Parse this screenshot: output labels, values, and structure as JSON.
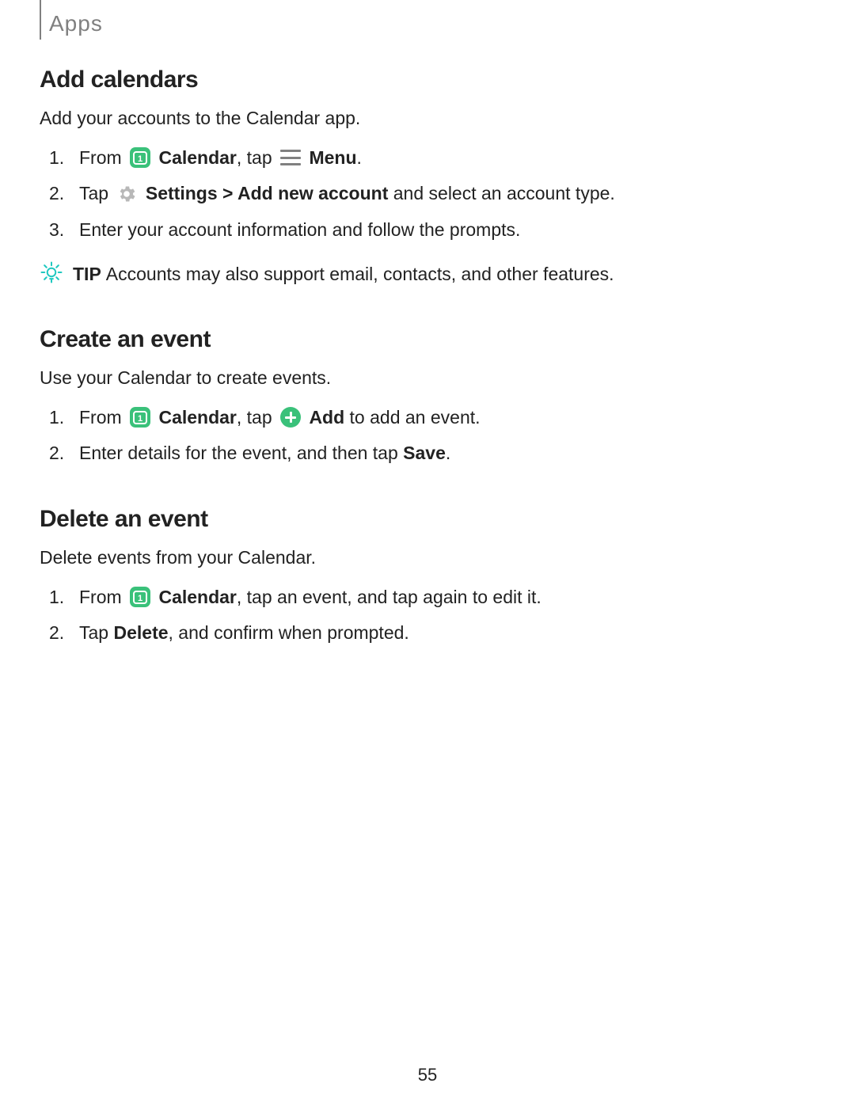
{
  "breadcrumb": "Apps",
  "page_number": "55",
  "tip_label": "TIP",
  "sections": {
    "add_calendars": {
      "heading": "Add calendars",
      "lead": "Add your accounts to the Calendar app.",
      "steps": {
        "s1": {
          "pre": "From ",
          "label1": "Calendar",
          "mid": ", tap ",
          "label2": "Menu",
          "post": "."
        },
        "s2": {
          "pre": "Tap ",
          "label1": "Settings > Add new account",
          "post": " and select an account type."
        },
        "s3": {
          "text": "Enter your account information and follow the prompts."
        }
      },
      "tip": "Accounts may also support email, contacts, and other features."
    },
    "create_event": {
      "heading": "Create an event",
      "lead": "Use your Calendar to create events.",
      "steps": {
        "s1": {
          "pre": "From ",
          "label1": "Calendar",
          "mid": ", tap ",
          "label2": "Add",
          "post": " to add an event."
        },
        "s2": {
          "pre": "Enter details for the event, and then tap ",
          "label1": "Save",
          "post": "."
        }
      }
    },
    "delete_event": {
      "heading": "Delete an event",
      "lead": "Delete events from your Calendar.",
      "steps": {
        "s1": {
          "pre": "From ",
          "label1": "Calendar",
          "post": ", tap an event, and tap again to edit it."
        },
        "s2": {
          "pre": "Tap ",
          "label1": "Delete",
          "post": ", and confirm when prompted."
        }
      }
    }
  }
}
